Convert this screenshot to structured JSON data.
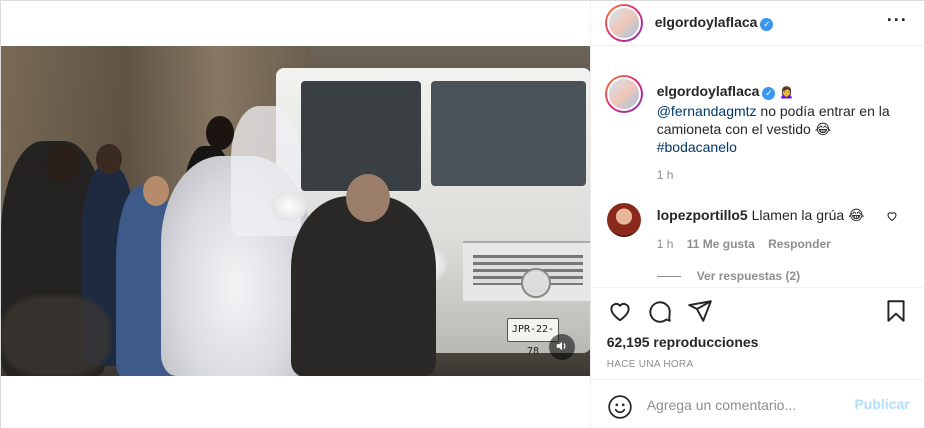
{
  "header": {
    "username": "elgordoylaflaca",
    "verified_icon": "verified-badge-icon",
    "more_icon": "more-options-icon"
  },
  "video": {
    "plate_text": "JPR-22-78",
    "sound_icon": "speaker-icon"
  },
  "caption": {
    "username": "elgordoylaflaca",
    "emoji_after_name": "🙍‍♀️",
    "mention": "@fernandagmtz",
    "text": " no podía entrar en la camioneta con el vestido 😂",
    "hashtag": "#bodacanelo",
    "time": "1 h"
  },
  "comments": [
    {
      "username": "lopezportillo5",
      "text": "Llamen la grúa 😂",
      "time": "1 h",
      "likes": "11 Me gusta",
      "reply_label": "Responder",
      "view_replies": "Ver respuestas (2)"
    }
  ],
  "actions": {
    "views": "62,195 reproducciones",
    "posted": "HACE UNA HORA"
  },
  "add_comment": {
    "placeholder": "Agrega un comentario...",
    "publish_label": "Publicar"
  },
  "colors": {
    "link": "#00376b",
    "verified": "#3897f0",
    "publish_disabled": "#b2dffc",
    "muted": "#8e8e8e"
  }
}
